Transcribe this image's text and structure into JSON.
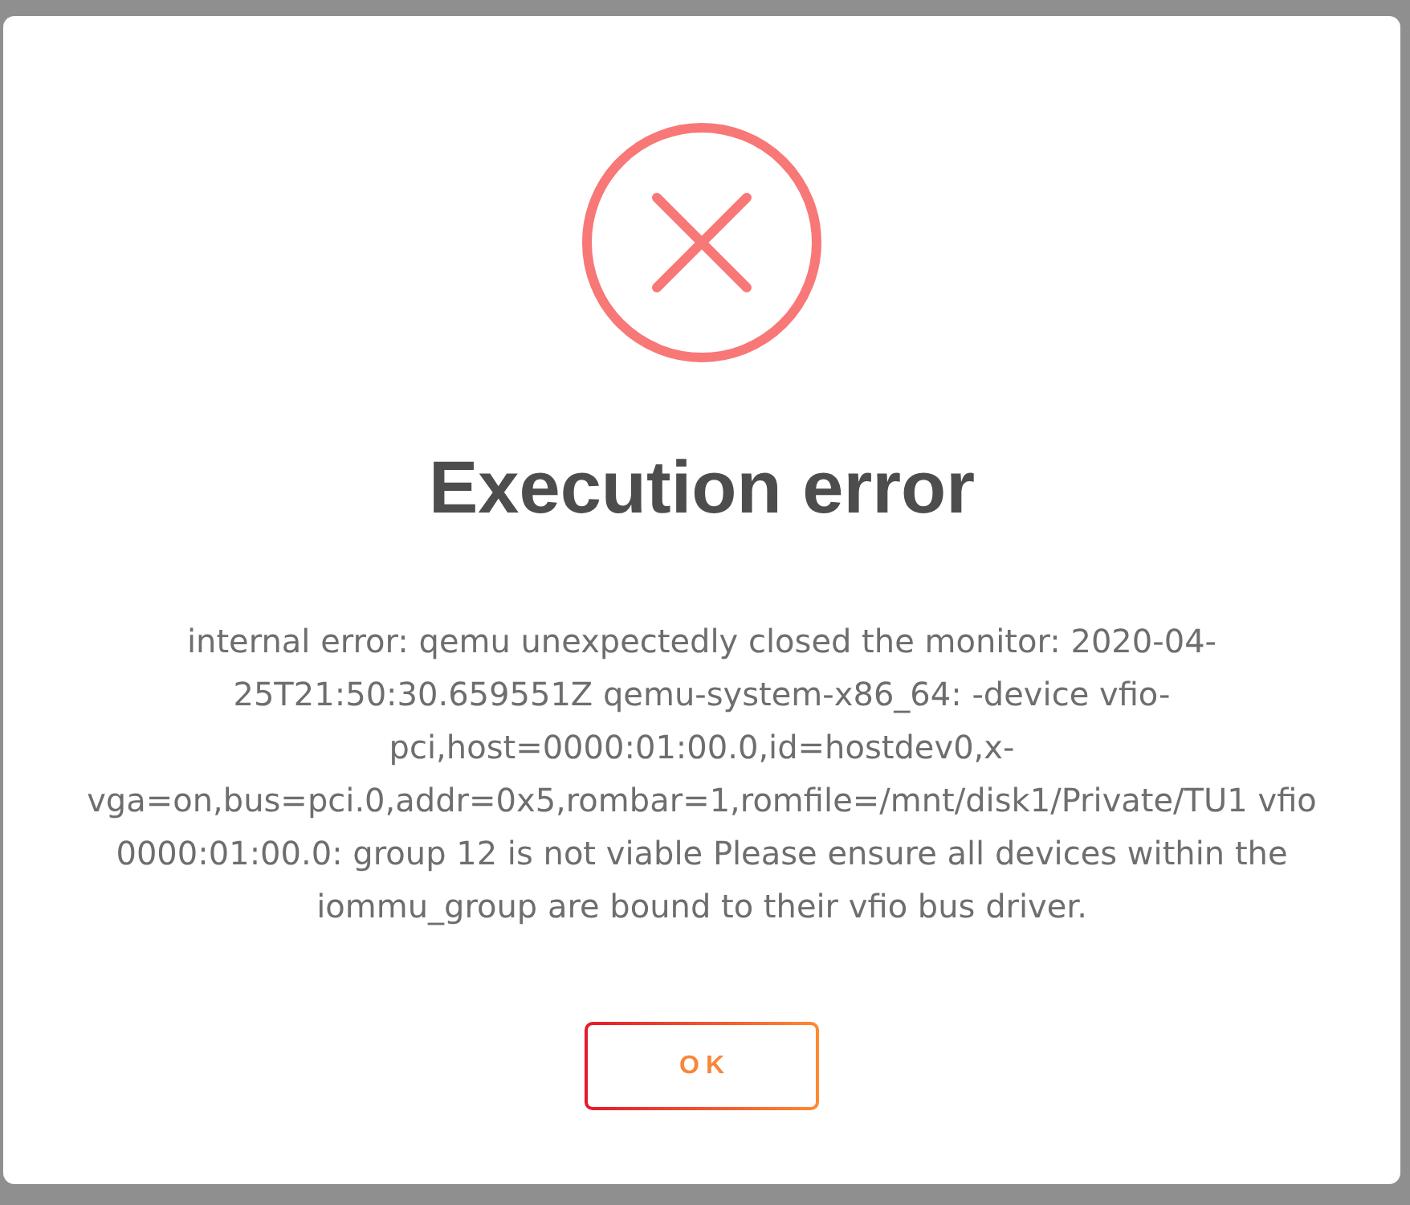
{
  "dialog": {
    "kind": "error",
    "title": "Execution error",
    "message": "internal error: qemu unexpectedly closed the monitor: 2020-04-25T21:50:30.659551Z qemu-system-x86_64: -device vfio-pci,host=0000:01:00.0,id=hostdev0,x-vga=on,bus=pci.0,addr=0x5,rombar=1,romfile=/mnt/disk1/Private/TU1 vfio 0000:01:00.0: group 12 is not viable Please ensure all devices within the iommu_group are bound to their vfio bus driver.",
    "buttons": [
      {
        "label": "OK"
      }
    ]
  }
}
